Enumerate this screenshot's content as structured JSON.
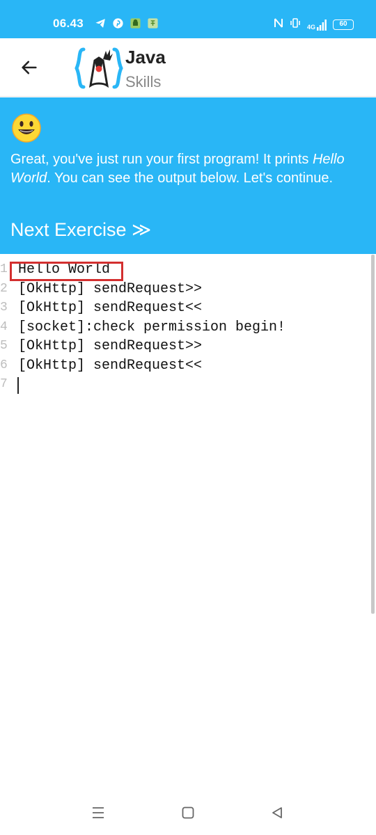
{
  "status_bar": {
    "time": "06.43",
    "icons_left": [
      "telegram-icon",
      "pinterest-icon",
      "android-icon",
      "app-notification-icon"
    ],
    "icons_right": [
      "nfc-icon",
      "vibrate-icon",
      "signal-icon",
      "battery-icon"
    ],
    "network": "4G",
    "battery": "60"
  },
  "app_bar": {
    "title_line1": "Java",
    "title_line2": "Skills"
  },
  "banner": {
    "message_part1": "Great, you've just run your first program! It prints ",
    "message_em": "Hello World",
    "message_part2": ". You can see the output below. Let's continue.",
    "next_label": "Next Exercise ≫"
  },
  "console": {
    "lines": [
      {
        "num": "1",
        "text": "Hello World"
      },
      {
        "num": "2",
        "text": "[OkHttp] sendRequest>>"
      },
      {
        "num": "3",
        "text": "[OkHttp] sendRequest<<"
      },
      {
        "num": "4",
        "text": "[socket]:check permission begin!"
      },
      {
        "num": "5",
        "text": "[OkHttp] sendRequest>>"
      },
      {
        "num": "6",
        "text": "[OkHttp] sendRequest<<"
      },
      {
        "num": "7",
        "text": ""
      }
    ]
  },
  "colors": {
    "accent": "#29b6f6",
    "highlight": "#d32f2f"
  },
  "nav_bar": {
    "buttons": [
      "recents-icon",
      "home-icon",
      "back-triangle-icon"
    ]
  }
}
